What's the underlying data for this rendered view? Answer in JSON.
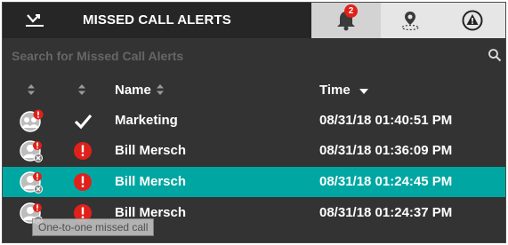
{
  "header": {
    "title": "MISSED CALL ALERTS",
    "alert_badge_count": "2"
  },
  "icons": {
    "title": "missed-call-icon",
    "tab_alerts": "bell-icon",
    "tab_location": "location-pin-icon",
    "tab_warning": "warning-triangle-icon",
    "search": "search-icon"
  },
  "search": {
    "placeholder": "Search for Missed Call Alerts",
    "value": ""
  },
  "columns": {
    "name": "Name",
    "time": "Time"
  },
  "rows": [
    {
      "name": "Marketing",
      "time": "08/31/18 01:40:51 PM",
      "avatar": "group-avatar-icon",
      "status": "checkmark-icon",
      "selected": false
    },
    {
      "name": "Bill Mersch",
      "time": "08/31/18 01:36:09 PM",
      "avatar": "user-missed-avatar-icon",
      "status": "alert-circle-icon",
      "selected": false
    },
    {
      "name": "Bill Mersch",
      "time": "08/31/18 01:24:45 PM",
      "avatar": "user-missed-avatar-icon",
      "status": "alert-circle-icon",
      "selected": true
    },
    {
      "name": "Bill Mersch",
      "time": "08/31/18 01:24:37 PM",
      "avatar": "user-missed-avatar-icon",
      "status": "alert-circle-icon",
      "selected": false
    }
  ],
  "tooltip": "One-to-one missed call",
  "colors": {
    "panel_bg": "#333333",
    "selected_row": "#00a7a2",
    "alert_red": "#e0201a"
  }
}
